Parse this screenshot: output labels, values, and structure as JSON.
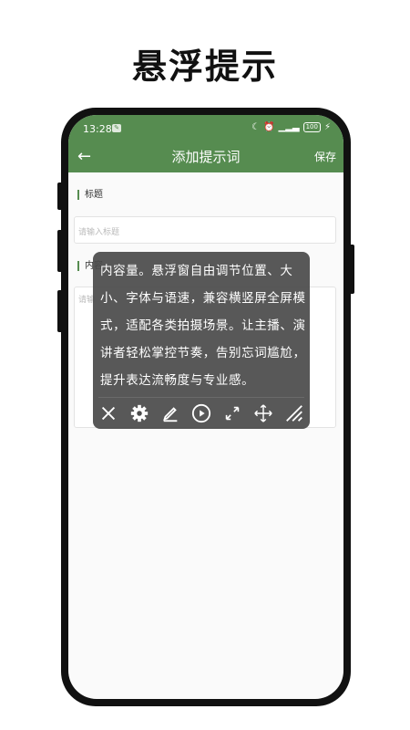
{
  "hero": {
    "title": "悬浮提示"
  },
  "status_bar": {
    "time": "13:28",
    "battery": "100"
  },
  "appbar": {
    "back_symbol": "←",
    "title": "添加提示词",
    "save_label": "保存"
  },
  "form": {
    "title_label": "标题",
    "title_placeholder": "请输入标题",
    "content_label": "内容",
    "content_placeholder": "请输"
  },
  "floating_window": {
    "text": "内容量。悬浮窗自由调节位置、大小、字体与语速，兼容横竖屏全屏模式，适配各类拍摄场景。让主播、演讲者轻松掌控节奏，告别忘词尴尬，提升表达流畅度与专业感。",
    "toolbar_icons": [
      "close-icon",
      "gear-icon",
      "edit-icon",
      "play-icon",
      "expand-icon",
      "move-icon",
      "resize-icon"
    ]
  },
  "colors": {
    "accent": "#568c50",
    "panel": "#4b4b4b"
  }
}
